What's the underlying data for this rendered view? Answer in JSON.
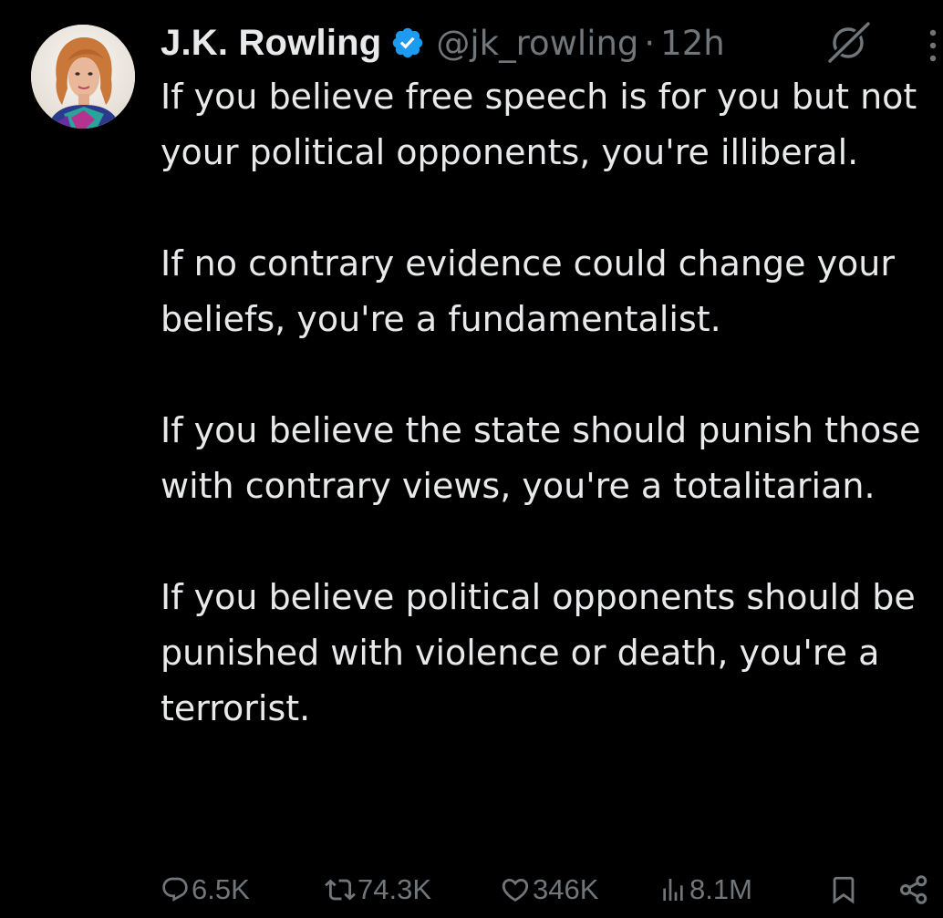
{
  "tweet": {
    "author": {
      "display_name": "J.K. Rowling",
      "handle": "@jk_rowling",
      "verified": true,
      "separator": "·",
      "time": "12h"
    },
    "paragraphs": [
      "If you believe free speech is for you but not your political opponents, you're illiberal.",
      "If no contrary evidence could change your beliefs, you're a fundamentalist.",
      "If you believe the state should punish those with contrary views, you're a totalitarian.",
      "If you believe political opponents should be punished with violence or death, you're a terrorist."
    ],
    "stats": {
      "replies": "6.5K",
      "reposts": "74.3K",
      "likes": "346K",
      "views": "8.1M"
    },
    "icons": {
      "reply": "reply-icon",
      "repost": "repost-icon",
      "like": "heart-icon",
      "views": "views-icon",
      "bookmark": "bookmark-icon",
      "share": "share-icon",
      "grok": "grok-icon",
      "more": "more-icon",
      "verified": "verified-badge-icon"
    }
  },
  "colors": {
    "background": "#000000",
    "text": "#e7e9ea",
    "muted": "#71767b",
    "verified_blue": "#1d9bf0"
  }
}
